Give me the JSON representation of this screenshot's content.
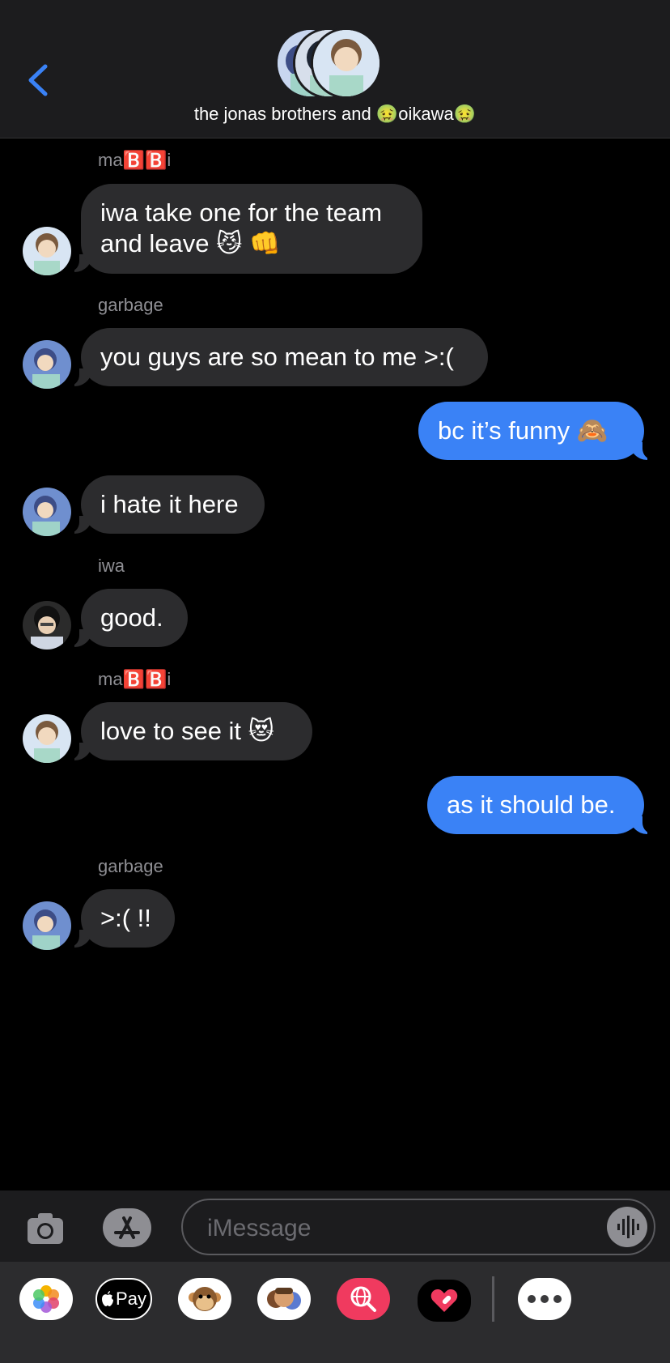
{
  "header": {
    "title_prefix": "the jonas brothers and ",
    "title_name": "oikawa",
    "title_emoji": "🤢"
  },
  "messages": [
    {
      "sender": "ma🅱️🅱️i",
      "text": "iwa take one for the team",
      "text2": "and leave 😼 👊"
    },
    {
      "sender": "garbage",
      "text": "you guys are so mean to me >:("
    },
    {
      "text": "bc it’s funny 🙈"
    },
    {
      "text": "i hate it here"
    },
    {
      "sender": "iwa",
      "text": "good."
    },
    {
      "sender": "ma🅱️🅱️i",
      "text": "love to see it 😻"
    },
    {
      "text": "as it should be."
    },
    {
      "sender": "garbage",
      "text": ">:( !!"
    }
  ],
  "input": {
    "placeholder": "iMessage"
  },
  "tray": {
    "apple_pay": "Pay"
  },
  "colors": {
    "blue": "#3a82f6",
    "bubble_gray": "#2c2c2e",
    "header_bg": "#1c1c1e"
  }
}
